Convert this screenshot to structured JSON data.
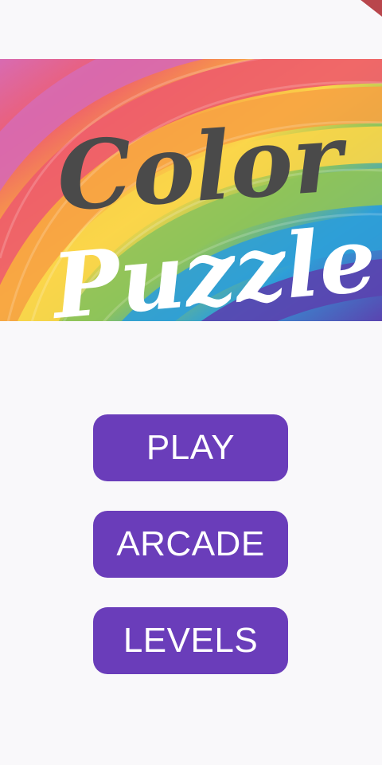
{
  "app": {
    "title_line1": "Color",
    "title_line2": "Puzzle"
  },
  "menu": {
    "play_label": "PLAY",
    "arcade_label": "ARCADE",
    "levels_label": "LEVELS"
  },
  "colors": {
    "background": "#f9f8fa",
    "button": "#6a3dba",
    "button_text": "#ffffff",
    "title_dark": "#4a4a4a",
    "title_light": "#ffffff",
    "rainbow": [
      "#ef5d6c",
      "#f8a443",
      "#fbd64a",
      "#8fc45a",
      "#2e9fd8",
      "#5a44b0"
    ]
  }
}
